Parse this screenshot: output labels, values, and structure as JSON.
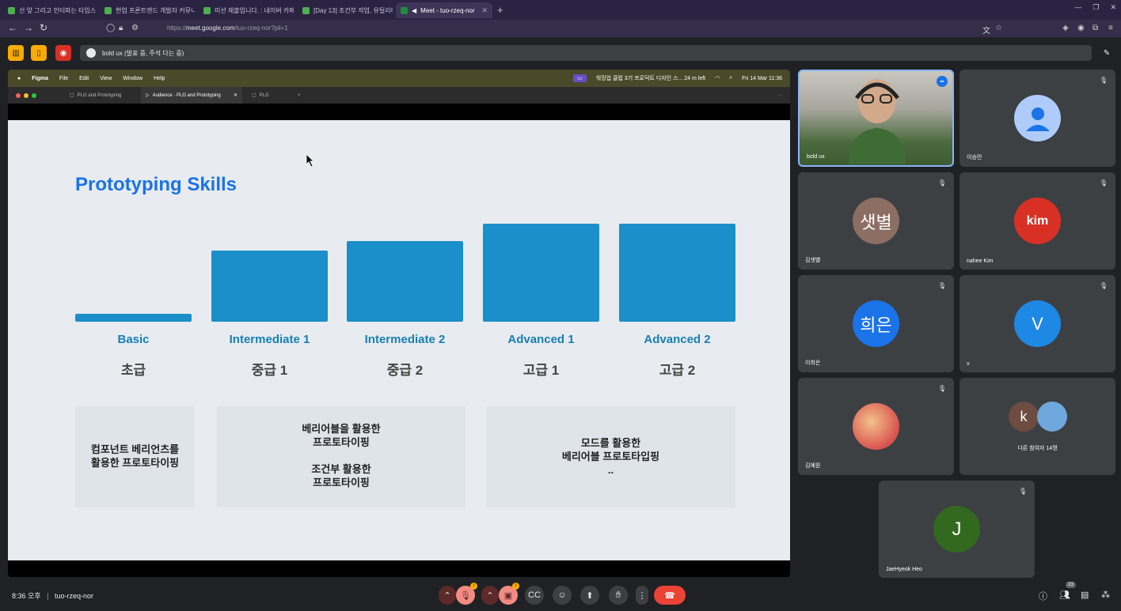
{
  "browser": {
    "tabs": [
      {
        "title": "선 앞 그리고 인터파는 타입스...",
        "color": "#4caf50"
      },
      {
        "title": "현업 프론트엔드 개발자 커뮤니...",
        "color": "#4caf50"
      },
      {
        "title": "미션 제출입니다. : 네이버 카페",
        "color": "#4caf50"
      },
      {
        "title": "[Day 13] 조건부 작업, 유틸리티",
        "color": "#4caf50"
      },
      {
        "title": "Meet - tuo-rzeq-nor",
        "color": "#1e8e3e"
      }
    ],
    "new_tab": "+",
    "url_prefix": "https://",
    "url_host": "meet.google.com",
    "url_path": "/tuo-rzeq-nor?pli=1"
  },
  "meet": {
    "presenting_banner": "bold ux (발표 중, 주석 다는 중)",
    "meeting_time": "8:36 오후",
    "meeting_code": "tuo-rzeq-nor",
    "participant_count": "23"
  },
  "presentation": {
    "mac_menu": [
      "Figma",
      "File",
      "Edit",
      "View",
      "Window",
      "Help"
    ],
    "status_text": "워밍업 클럽 3기 프로덕트 디자인 스...  24 m left",
    "clock": "Fri 14 Mar  11:36",
    "figma_tabs": [
      "PLG and Prototyping",
      "Audience · PLG and Prototyping",
      "PLG"
    ],
    "slide_title": "Prototyping Skills",
    "levels": [
      {
        "en": "Basic",
        "ko": "초급"
      },
      {
        "en": "Intermediate 1",
        "ko": "중급 1"
      },
      {
        "en": "Intermediate 2",
        "ko": "중급 2"
      },
      {
        "en": "Advanced 1",
        "ko": "고급 1"
      },
      {
        "en": "Advanced 2",
        "ko": "고급 2"
      }
    ],
    "bar_levels": [
      0.08,
      0.7,
      0.8,
      0.97,
      0.97
    ],
    "notes": [
      "컴포넌트 베리언츠를\n활용한 프로토타이핑",
      "베리어블을 활용한\n프로토타이핑\n\n조건부 활용한\n프로토타이핑",
      "모드를 활용한\n베리어블 프로토타입핑\n.."
    ]
  },
  "participants": [
    {
      "name": "bold ux",
      "initial": "",
      "color": "#8a8f7a"
    },
    {
      "name": "이승민",
      "initial": "",
      "color": "#aecbfa"
    },
    {
      "name": "김샛별",
      "initial": "샛별",
      "color": "#8d6e63"
    },
    {
      "name": "nahee Kim",
      "initial": "kim",
      "color": "#d93025"
    },
    {
      "name": "이희은",
      "initial": "희은",
      "color": "#1a73e8"
    },
    {
      "name": "v",
      "initial": "V",
      "color": "#1e88e5"
    },
    {
      "name": "김예원",
      "initial": "",
      "color": "#e57373"
    },
    {
      "name": "다른 참여자 14명",
      "initial": "k",
      "color": "#6d4c41"
    },
    {
      "name": "JaeHyeok Heo",
      "initial": "J",
      "color": "#33691e"
    }
  ],
  "icons": {
    "mic_off": "mic-off-icon",
    "cam_off": "camera-off-icon",
    "hangup": "hangup-icon"
  },
  "colors": {
    "accent": "#1a73e8",
    "bar": "#1a8fc9",
    "hangup": "#ea4335"
  }
}
